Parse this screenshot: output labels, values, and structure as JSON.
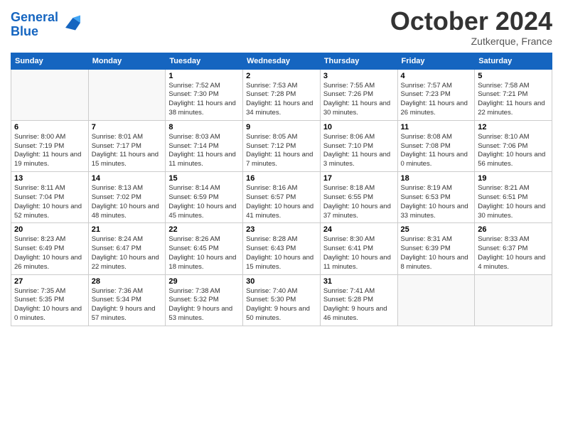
{
  "header": {
    "logo_line1": "General",
    "logo_line2": "Blue",
    "month": "October 2024",
    "location": "Zutkerque, France"
  },
  "weekdays": [
    "Sunday",
    "Monday",
    "Tuesday",
    "Wednesday",
    "Thursday",
    "Friday",
    "Saturday"
  ],
  "weeks": [
    [
      {
        "day": "",
        "info": ""
      },
      {
        "day": "",
        "info": ""
      },
      {
        "day": "1",
        "info": "Sunrise: 7:52 AM\nSunset: 7:30 PM\nDaylight: 11 hours and 38 minutes."
      },
      {
        "day": "2",
        "info": "Sunrise: 7:53 AM\nSunset: 7:28 PM\nDaylight: 11 hours and 34 minutes."
      },
      {
        "day": "3",
        "info": "Sunrise: 7:55 AM\nSunset: 7:26 PM\nDaylight: 11 hours and 30 minutes."
      },
      {
        "day": "4",
        "info": "Sunrise: 7:57 AM\nSunset: 7:23 PM\nDaylight: 11 hours and 26 minutes."
      },
      {
        "day": "5",
        "info": "Sunrise: 7:58 AM\nSunset: 7:21 PM\nDaylight: 11 hours and 22 minutes."
      }
    ],
    [
      {
        "day": "6",
        "info": "Sunrise: 8:00 AM\nSunset: 7:19 PM\nDaylight: 11 hours and 19 minutes."
      },
      {
        "day": "7",
        "info": "Sunrise: 8:01 AM\nSunset: 7:17 PM\nDaylight: 11 hours and 15 minutes."
      },
      {
        "day": "8",
        "info": "Sunrise: 8:03 AM\nSunset: 7:14 PM\nDaylight: 11 hours and 11 minutes."
      },
      {
        "day": "9",
        "info": "Sunrise: 8:05 AM\nSunset: 7:12 PM\nDaylight: 11 hours and 7 minutes."
      },
      {
        "day": "10",
        "info": "Sunrise: 8:06 AM\nSunset: 7:10 PM\nDaylight: 11 hours and 3 minutes."
      },
      {
        "day": "11",
        "info": "Sunrise: 8:08 AM\nSunset: 7:08 PM\nDaylight: 11 hours and 0 minutes."
      },
      {
        "day": "12",
        "info": "Sunrise: 8:10 AM\nSunset: 7:06 PM\nDaylight: 10 hours and 56 minutes."
      }
    ],
    [
      {
        "day": "13",
        "info": "Sunrise: 8:11 AM\nSunset: 7:04 PM\nDaylight: 10 hours and 52 minutes."
      },
      {
        "day": "14",
        "info": "Sunrise: 8:13 AM\nSunset: 7:02 PM\nDaylight: 10 hours and 48 minutes."
      },
      {
        "day": "15",
        "info": "Sunrise: 8:14 AM\nSunset: 6:59 PM\nDaylight: 10 hours and 45 minutes."
      },
      {
        "day": "16",
        "info": "Sunrise: 8:16 AM\nSunset: 6:57 PM\nDaylight: 10 hours and 41 minutes."
      },
      {
        "day": "17",
        "info": "Sunrise: 8:18 AM\nSunset: 6:55 PM\nDaylight: 10 hours and 37 minutes."
      },
      {
        "day": "18",
        "info": "Sunrise: 8:19 AM\nSunset: 6:53 PM\nDaylight: 10 hours and 33 minutes."
      },
      {
        "day": "19",
        "info": "Sunrise: 8:21 AM\nSunset: 6:51 PM\nDaylight: 10 hours and 30 minutes."
      }
    ],
    [
      {
        "day": "20",
        "info": "Sunrise: 8:23 AM\nSunset: 6:49 PM\nDaylight: 10 hours and 26 minutes."
      },
      {
        "day": "21",
        "info": "Sunrise: 8:24 AM\nSunset: 6:47 PM\nDaylight: 10 hours and 22 minutes."
      },
      {
        "day": "22",
        "info": "Sunrise: 8:26 AM\nSunset: 6:45 PM\nDaylight: 10 hours and 18 minutes."
      },
      {
        "day": "23",
        "info": "Sunrise: 8:28 AM\nSunset: 6:43 PM\nDaylight: 10 hours and 15 minutes."
      },
      {
        "day": "24",
        "info": "Sunrise: 8:30 AM\nSunset: 6:41 PM\nDaylight: 10 hours and 11 minutes."
      },
      {
        "day": "25",
        "info": "Sunrise: 8:31 AM\nSunset: 6:39 PM\nDaylight: 10 hours and 8 minutes."
      },
      {
        "day": "26",
        "info": "Sunrise: 8:33 AM\nSunset: 6:37 PM\nDaylight: 10 hours and 4 minutes."
      }
    ],
    [
      {
        "day": "27",
        "info": "Sunrise: 7:35 AM\nSunset: 5:35 PM\nDaylight: 10 hours and 0 minutes."
      },
      {
        "day": "28",
        "info": "Sunrise: 7:36 AM\nSunset: 5:34 PM\nDaylight: 9 hours and 57 minutes."
      },
      {
        "day": "29",
        "info": "Sunrise: 7:38 AM\nSunset: 5:32 PM\nDaylight: 9 hours and 53 minutes."
      },
      {
        "day": "30",
        "info": "Sunrise: 7:40 AM\nSunset: 5:30 PM\nDaylight: 9 hours and 50 minutes."
      },
      {
        "day": "31",
        "info": "Sunrise: 7:41 AM\nSunset: 5:28 PM\nDaylight: 9 hours and 46 minutes."
      },
      {
        "day": "",
        "info": ""
      },
      {
        "day": "",
        "info": ""
      }
    ]
  ]
}
